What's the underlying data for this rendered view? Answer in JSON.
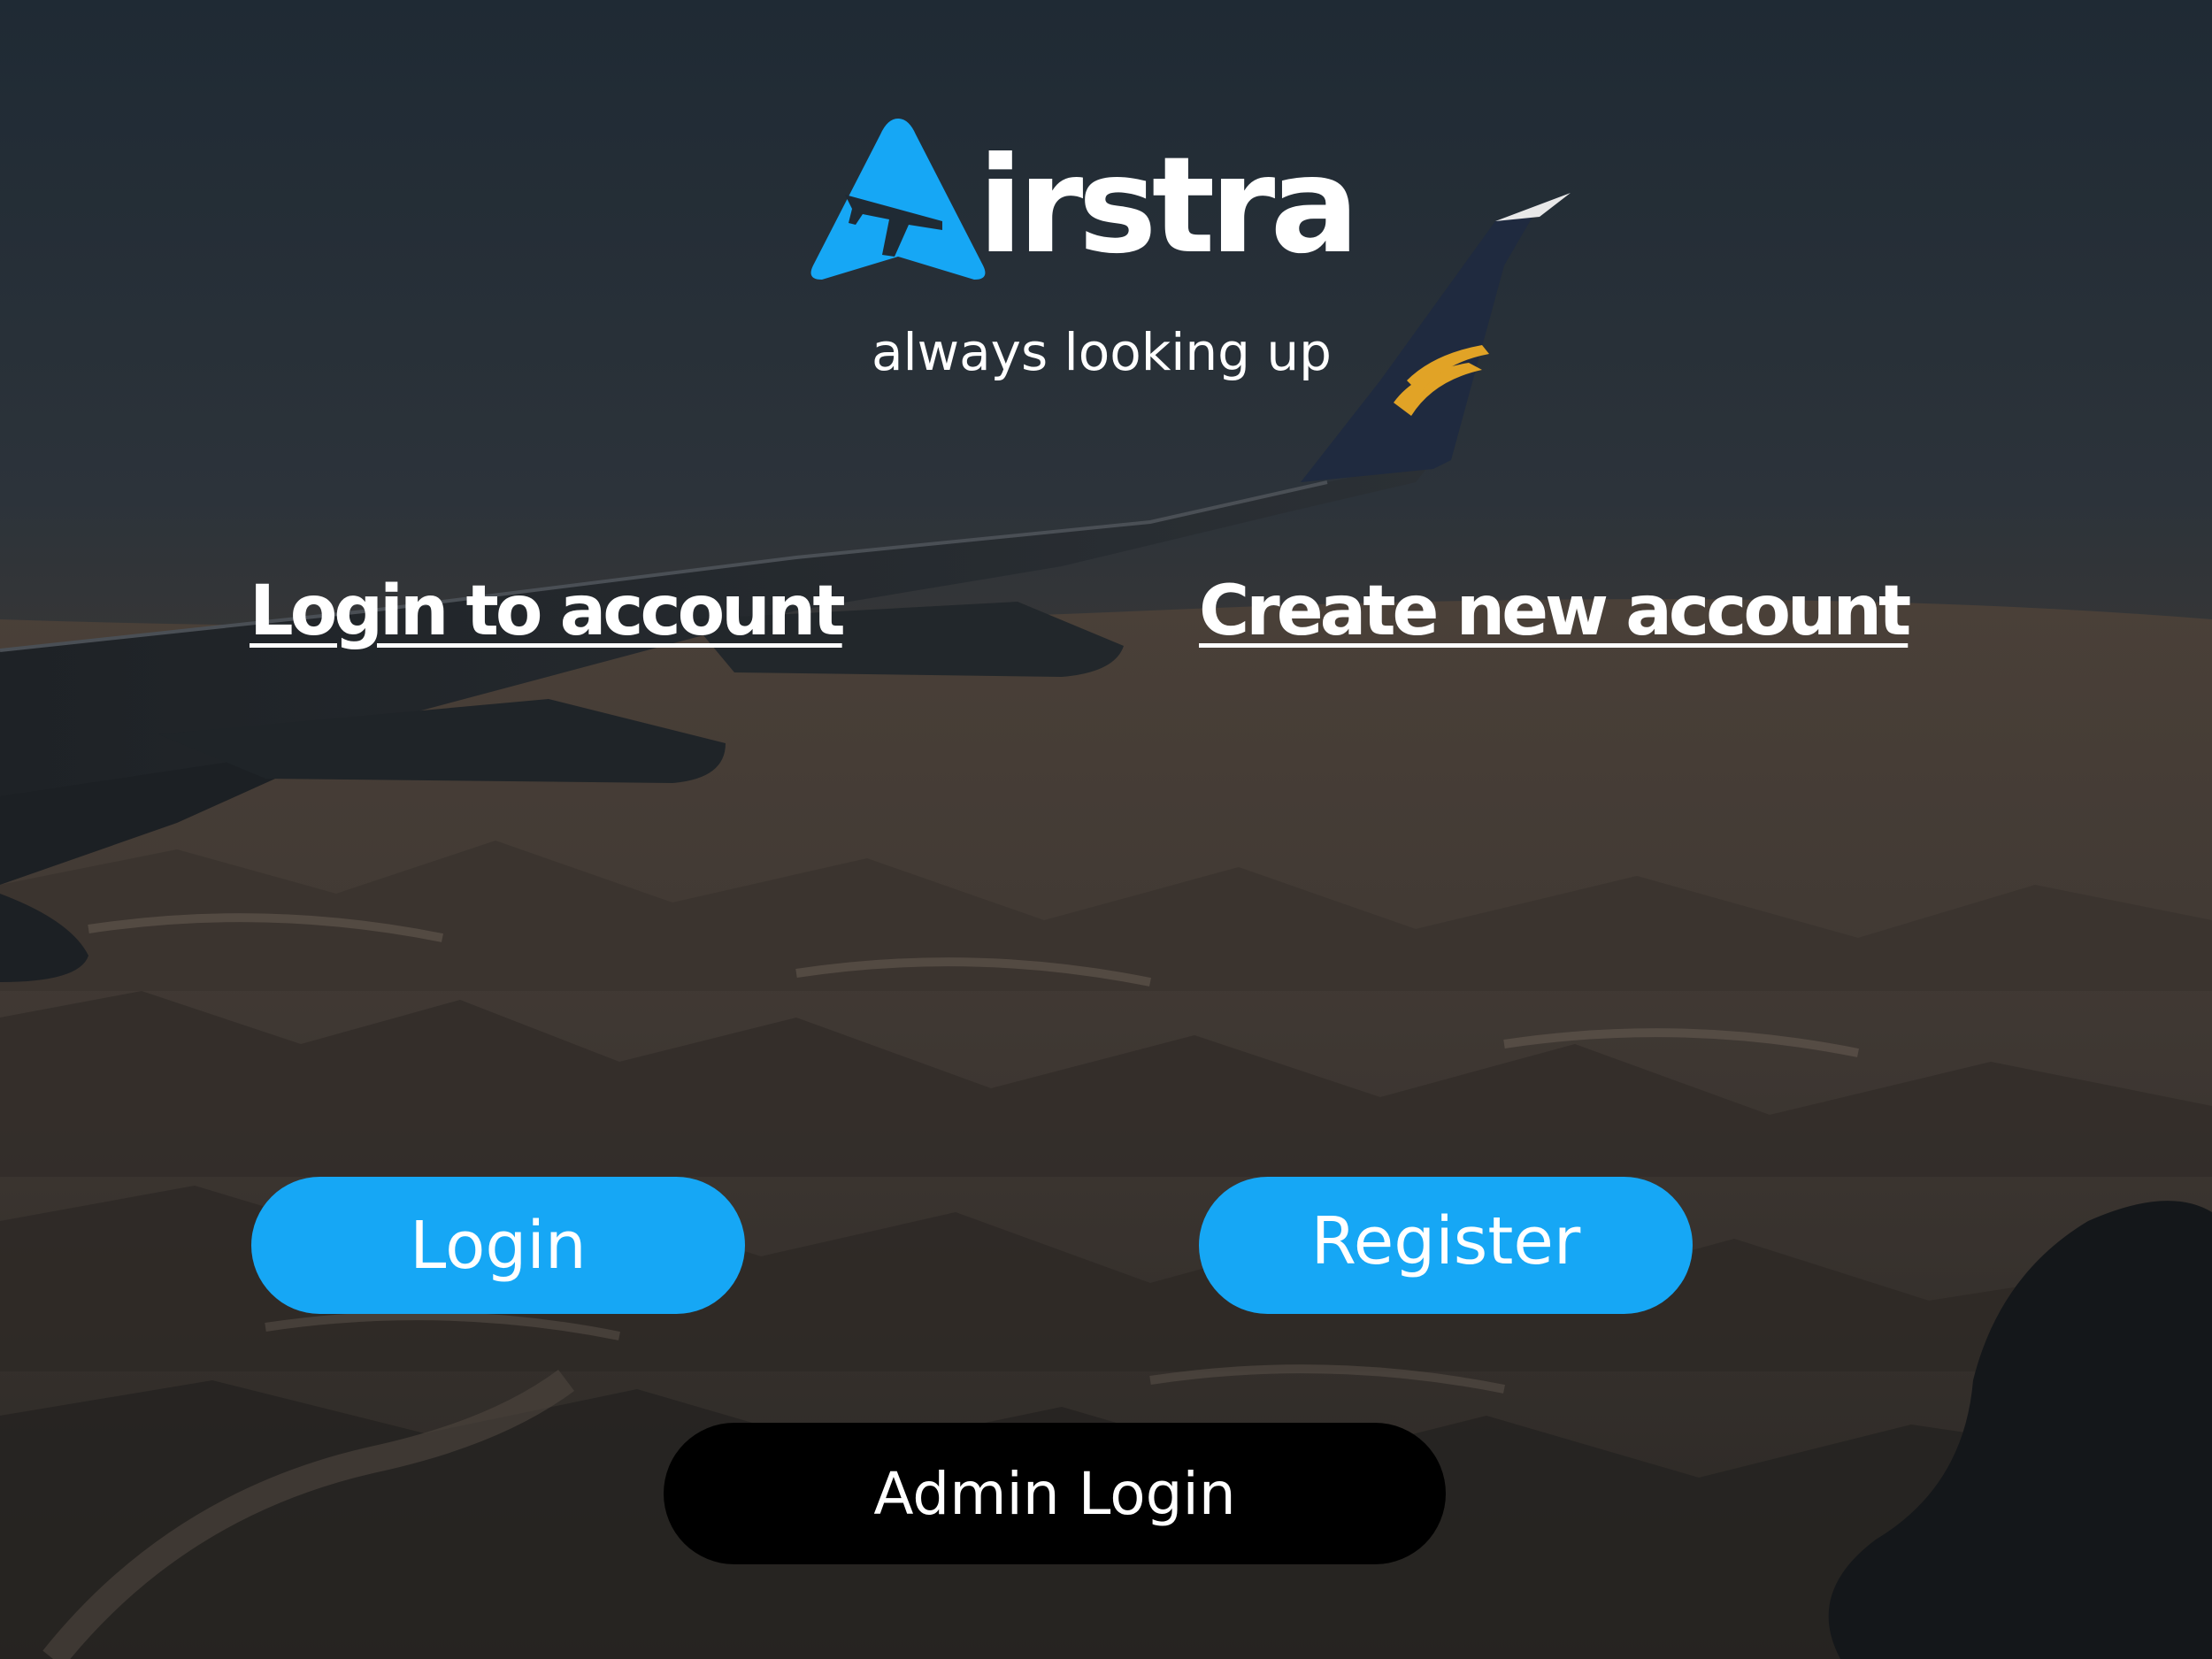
{
  "brand": {
    "name_rest": "irstra",
    "tagline": "always looking up",
    "accent_color": "#16a7f5",
    "logo_icon": "airplane-triangle-icon"
  },
  "headings": {
    "login": "Login to account",
    "create": "Create new account"
  },
  "buttons": {
    "login": "Login",
    "register": "Register",
    "admin": "Admin Login"
  },
  "background": {
    "description_icon": "airplane-wing-over-mountains"
  }
}
